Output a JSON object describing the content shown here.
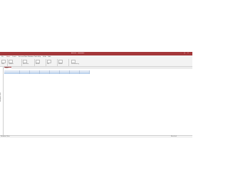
{
  "window": {
    "title": "Access - Database",
    "minimize": "–",
    "maximize": "□",
    "close": "✕",
    "brand_color": "#a4373a"
  },
  "ribbon": {
    "tabs": [
      "File",
      "Home",
      "Create",
      "External Data",
      "Database Tools",
      "Help",
      "Fields",
      "Table"
    ],
    "active_tab": "Home",
    "groups": [
      "Views",
      "Clipboard",
      "Sort & Filter",
      "Records",
      "Find",
      "Window",
      "Text Formatting"
    ]
  },
  "navigation_pane": {
    "label": "Navigation Pane"
  },
  "document": {
    "tab_label": "Table1"
  },
  "grid": {
    "columns": [
      "ID",
      "Field1",
      "Field2",
      "Field3",
      "Field4",
      "Field5",
      "Field6",
      "Field7"
    ],
    "rows": [
      [
        "1",
        "",
        "",
        "",
        "",
        "",
        "",
        ""
      ]
    ],
    "new_row_marker": "*"
  },
  "status": {
    "left": "Datasheet View",
    "right": "Num Lock"
  }
}
